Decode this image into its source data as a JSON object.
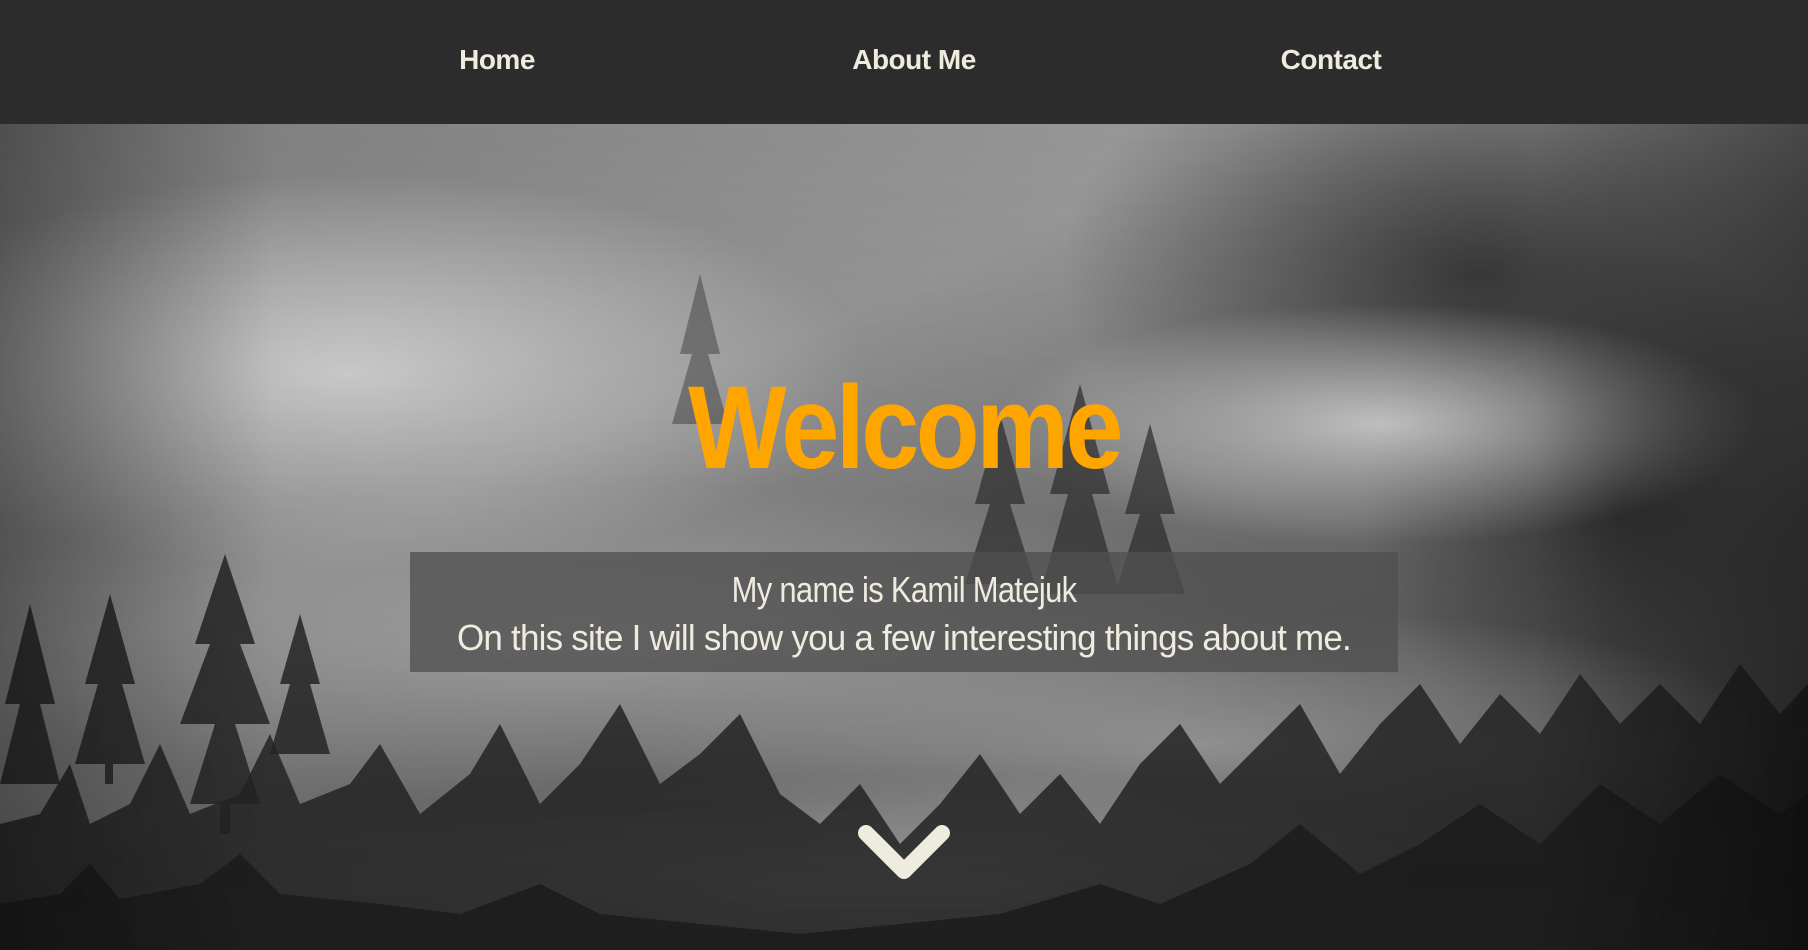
{
  "nav": {
    "home_label": "Home",
    "about_label": "About Me",
    "contact_label": "Contact"
  },
  "hero": {
    "title": "Welcome",
    "intro_line_1": "My name is Kamil Matejuk",
    "intro_line_2": "On this site I will show you a few interesting things about me.",
    "scroll_icon": "chevron-down-icon",
    "background": "foggy-forest-grayscale-photo"
  },
  "colors": {
    "navbar": "#2c2c2c",
    "nav_text": "#efebdf",
    "title": "#ffa500",
    "intro_box": "#505050",
    "intro_text": "#efebdf",
    "chevron": "#efebdf"
  }
}
